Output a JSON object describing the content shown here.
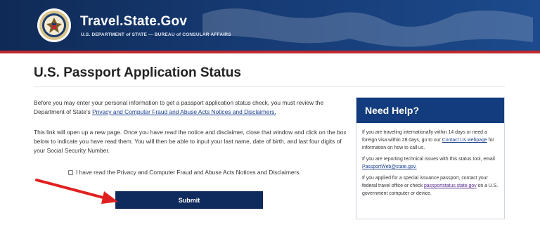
{
  "header": {
    "title": "Travel.State.Gov",
    "subtitle": "U.S. DEPARTMENT of STATE — BUREAU of CONSULAR AFFAIRS"
  },
  "page": {
    "title": "U.S. Passport Application Status"
  },
  "intro": {
    "text": "Before you may enter your personal information to get a passport application status check, you must review the Department of State's ",
    "link": "Privacy and Computer Fraud and Abuse Acts Notices and Disclaimers."
  },
  "instructions": {
    "text": "This link will open up a new page. Once you have read the notice and disclaimer, close that window and click on the box below to indicate you have read them. You will then be able to input your last name, date of birth, and last four digits of your Social Security Number."
  },
  "agreement": {
    "checked": false,
    "label": "I have read the Privacy and Computer Fraud and Abuse Acts Notices and Disclaimers."
  },
  "submit_label": "Submit",
  "help": {
    "heading": "Need Help?",
    "p1_text": "If you are traveling internationally within 14 days or need a foreign visa within 28 days, go to our ",
    "p1_link": "Contact Us webpage",
    "p1_tail": " for information on how to call us.",
    "p2_text": "If you are reporting technical issues with this status tool, email ",
    "p2_link": "PassportWeb@state.gov.",
    "p3_text": "If you applied for a special issuance passport, contact your federal travel office or check ",
    "p3_link": "passportstatus.state.gov",
    "p3_tail": " on a U.S. government computer or device."
  },
  "colors": {
    "header_blue": "#0f2a55",
    "accent_red": "#c0282d",
    "button_navy": "#0f2a5c",
    "help_heading": "#123c7d",
    "arrow_red": "#e02020"
  }
}
